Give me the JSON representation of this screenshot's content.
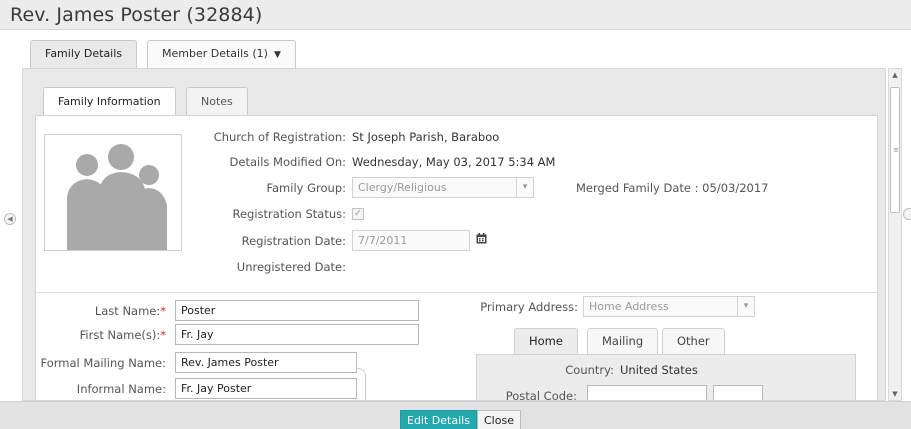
{
  "window": {
    "title": "Rev. James Poster (32884)"
  },
  "outer_tabs": [
    {
      "label": "Family Details",
      "active": true
    },
    {
      "label": "Member Details (1)",
      "active": false,
      "caret": "▼"
    }
  ],
  "inner_tabs": [
    {
      "label": "Family Information",
      "active": true
    },
    {
      "label": "Notes",
      "active": false
    }
  ],
  "family_info": {
    "church_label": "Church of Registration:",
    "church_value": "St Joseph Parish, Baraboo",
    "modified_label": "Details Modified On:",
    "modified_value": "Wednesday, May 03, 2017 5:34 AM",
    "group_label": "Family Group:",
    "group_value": "Clergy/Religious",
    "merged_label": "Merged Family Date : 05/03/2017",
    "status_label": "Registration Status:",
    "status_checked": true,
    "regdate_label": "Registration Date:",
    "regdate_value": "7/7/2011",
    "unreg_label": "Unregistered Date:"
  },
  "names": {
    "last_label": "Last Name:",
    "last_value": "Poster",
    "first_label": "First Name(s):",
    "first_value": "Fr. Jay",
    "formal_label": "Formal Mailing Name:",
    "formal_value": "Rev. James  Poster",
    "informal_label": "Informal Name:",
    "informal_value": "Fr. Jay Poster",
    "required_mark": "*"
  },
  "address": {
    "primary_label": "Primary Address:",
    "primary_value": "Home Address",
    "tabs": [
      {
        "label": "Home",
        "active": true
      },
      {
        "label": "Mailing",
        "active": false
      },
      {
        "label": "Other",
        "active": false
      }
    ],
    "country_label": "Country:",
    "country_value": "United States",
    "postal_label": "Postal Code:"
  },
  "footer": {
    "edit_label": "Edit Details",
    "close_label": "Close"
  },
  "colors": {
    "accent": "#23a9ad",
    "required": "#d32b2b"
  }
}
